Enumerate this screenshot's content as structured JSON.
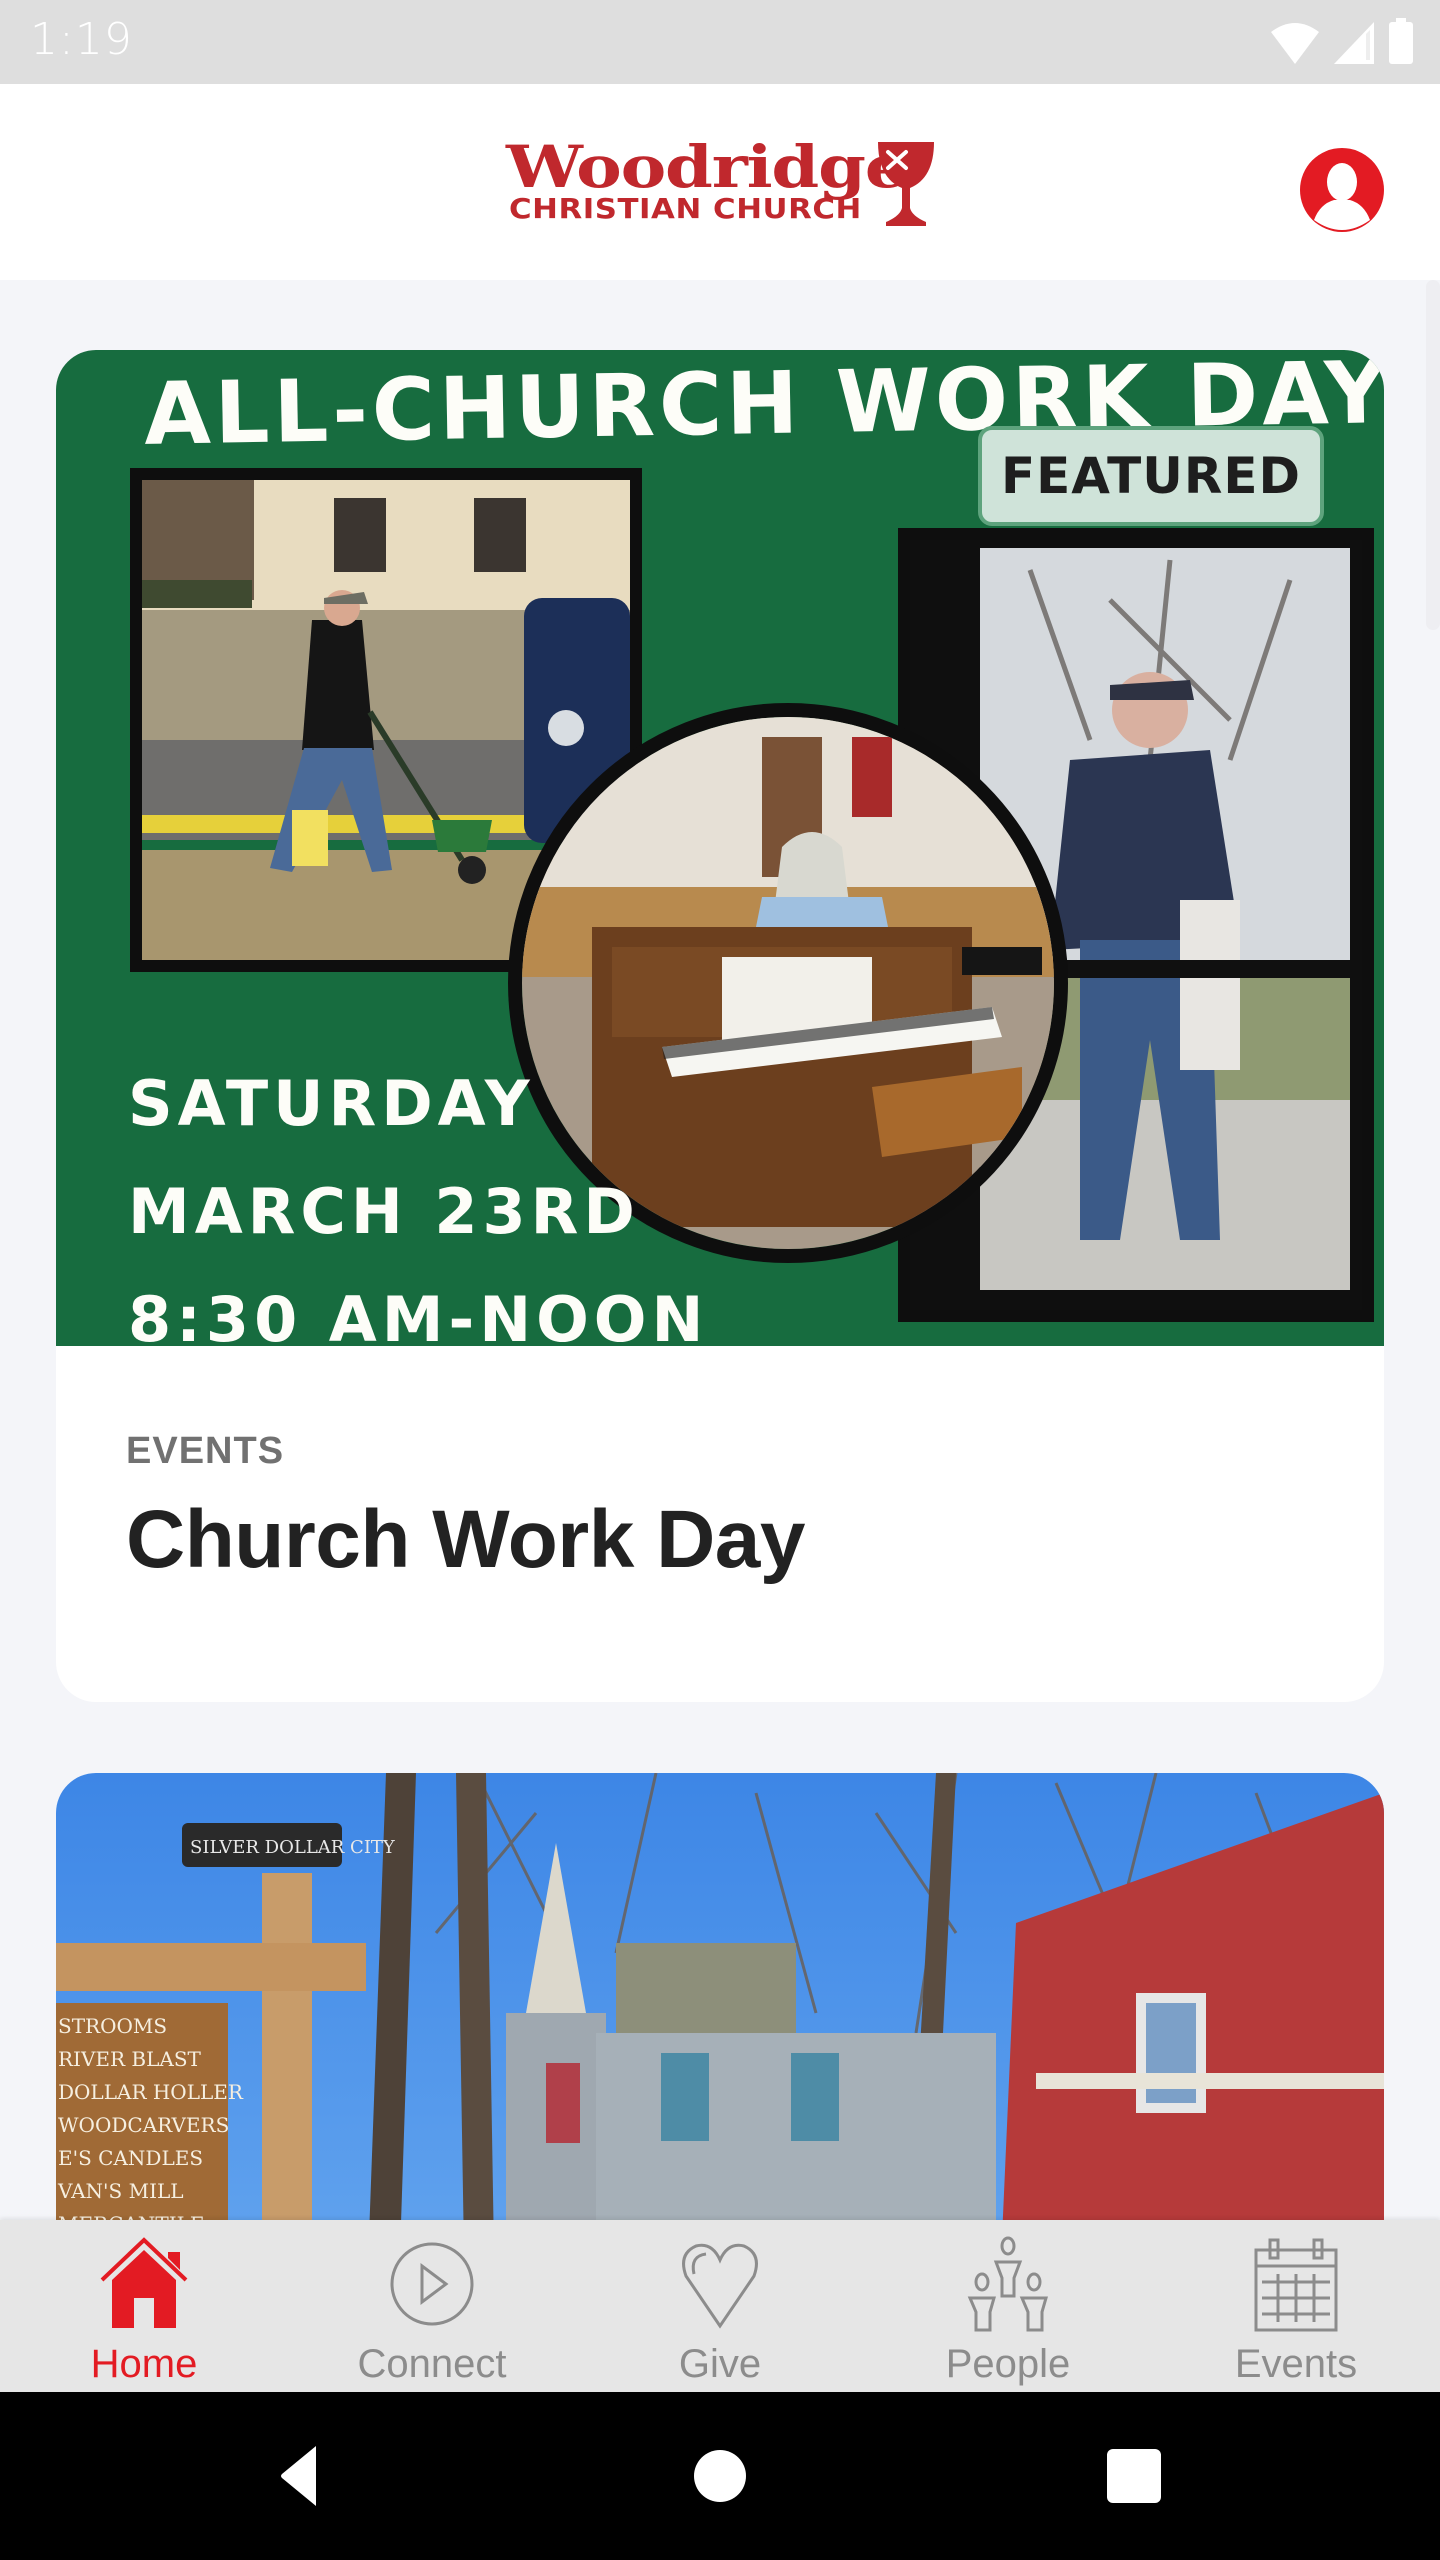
{
  "status_bar": {
    "time": "1:19",
    "icons": [
      "wifi-icon",
      "cellular-signal-icon",
      "battery-icon"
    ]
  },
  "header": {
    "logo_name": "Woodridge",
    "logo_subtitle": "CHRISTIAN CHURCH",
    "logo_icon": "chalice-icon",
    "profile_icon": "user-profile-icon"
  },
  "colors": {
    "brand_red": "#e31b23",
    "logo_red": "#c0282d",
    "flyer_green": "#176c3f",
    "badge_bg": "#cfe3d9",
    "tab_inactive": "#8c8c8c",
    "page_bg": "#f4f5f9"
  },
  "feed": {
    "items": [
      {
        "badge": "FEATURED",
        "image": {
          "headline": "ALL-CHURCH WORK DAY",
          "lines": [
            "SATURDAY",
            "MARCH 23RD",
            "8:30 AM-NOON"
          ],
          "photos": [
            "man-spreading-lawn-seed-photo",
            "woman-cleaning-piano-photo",
            "man-washing-window-photo"
          ]
        },
        "category": "EVENTS",
        "title": "Church Work Day"
      },
      {
        "image": {
          "sign_text": "SILVER DOLLAR CITY",
          "signposts": [
            "RESTROOMS",
            "RIVER BLAST",
            "DOLLAR HOLLER",
            "WOODCARVERS",
            "CANDLES",
            "MILL",
            "MERCANTILE"
          ],
          "description": "group-photo-at-silver-dollar-city"
        }
      }
    ]
  },
  "tabs": [
    {
      "label": "Home",
      "icon": "home-icon",
      "active": true
    },
    {
      "label": "Connect",
      "icon": "play-circle-icon",
      "active": false
    },
    {
      "label": "Give",
      "icon": "heart-icon",
      "active": false
    },
    {
      "label": "People",
      "icon": "people-icon",
      "active": false
    },
    {
      "label": "Events",
      "icon": "calendar-icon",
      "active": false
    }
  ],
  "system_nav": [
    "back-icon",
    "home-circle-icon",
    "recents-icon"
  ]
}
